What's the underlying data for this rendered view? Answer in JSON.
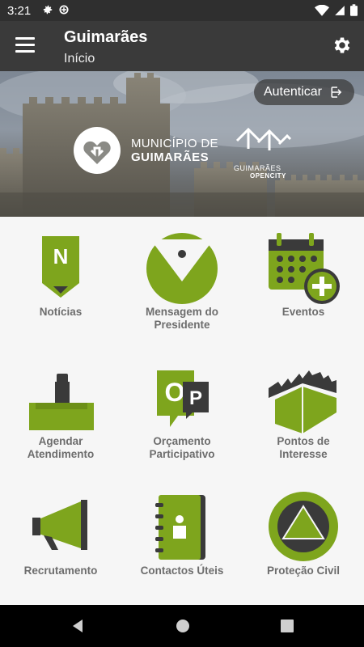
{
  "status_bar": {
    "time": "3:21"
  },
  "app_bar": {
    "title": "Guimarães",
    "subtitle": "Início"
  },
  "hero": {
    "auth_label": "Autenticar",
    "municipio_line1": "MUNICÍPIO DE",
    "municipio_line2": "GUIMARÃES",
    "opencity_line1": "GUIMARÃES",
    "opencity_line2": "OPENCITY"
  },
  "tiles": [
    {
      "label1": "Notícias",
      "label2": ""
    },
    {
      "label1": "Mensagem do",
      "label2": "Presidente"
    },
    {
      "label1": "Eventos",
      "label2": ""
    },
    {
      "label1": "Agendar",
      "label2": "Atendimento"
    },
    {
      "label1": "Orçamento",
      "label2": "Participativo"
    },
    {
      "label1": "Pontos de",
      "label2": "Interesse"
    },
    {
      "label1": "Recrutamento",
      "label2": ""
    },
    {
      "label1": "Contactos Úteis",
      "label2": ""
    },
    {
      "label1": "Proteção Civil",
      "label2": ""
    }
  ],
  "colors": {
    "accent": "#7ea51d",
    "dark": "#3a3a3a",
    "label": "#6d6d6d"
  },
  "icons": {
    "tiles": [
      "news-icon",
      "president-message-icon",
      "events-calendar-icon",
      "appointment-icon",
      "participatory-budget-icon",
      "points-of-interest-icon",
      "recruitment-megaphone-icon",
      "useful-contacts-icon",
      "civil-protection-icon"
    ]
  }
}
